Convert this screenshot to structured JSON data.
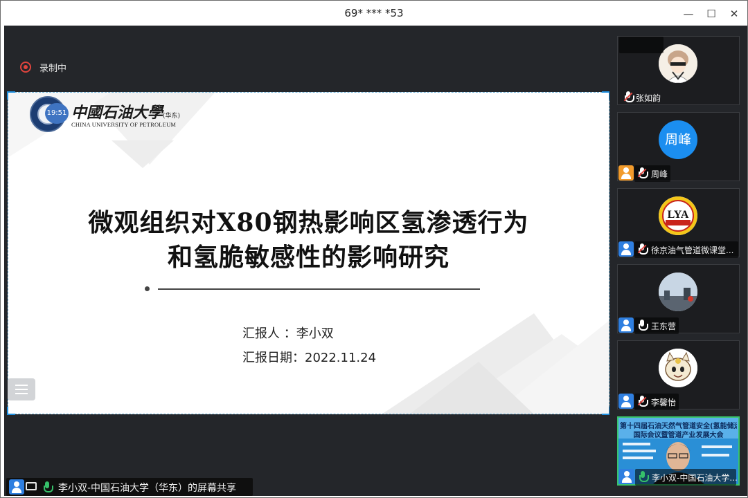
{
  "window": {
    "title": "69* *** *53",
    "minimize_glyph": "—",
    "maximize_glyph": "☐",
    "close_glyph": "✕"
  },
  "recording": {
    "label": "录制中",
    "color": "#e0443e"
  },
  "slide": {
    "clock_badge": "19:51",
    "logo_cn": "中國石油大學",
    "logo_cn_suffix": "(华东)",
    "logo_en": "CHINA UNIVERSITY OF PETROLEUM",
    "title_line1": "微观组织对X80钢热影响区氢渗透行为",
    "title_line2": "和氢脆敏感性的影响研究",
    "reporter": "汇报人  ：李小双",
    "date": "汇报日期：2022.11.24"
  },
  "share_bar": {
    "text": "李小双-中国石油大学（华东）的屏幕共享",
    "icons": [
      "user-icon",
      "screen-share-icon",
      "mic-active-icon"
    ]
  },
  "participants": [
    {
      "name": "张如韵",
      "avatar": "cartoon-girl-avatar",
      "mic": "muted",
      "show_user_icon": false
    },
    {
      "name": "周峰",
      "avatar_text": "周峰",
      "avatar": "text-avatar",
      "mic": "muted",
      "show_user_icon": true,
      "user_icon_color": "#f29b2c"
    },
    {
      "name": "徐京油气管道微课堂...",
      "avatar": "lya-logo-avatar",
      "mic": "muted",
      "show_user_icon": true,
      "user_icon_color": "#2f7fe0"
    },
    {
      "name": "王东营",
      "avatar": "landscape-photo-avatar",
      "mic": "on",
      "show_user_icon": true,
      "user_icon_color": "#2f7fe0"
    },
    {
      "name": "李馨怡",
      "avatar": "cartoon-cat-avatar",
      "mic": "muted",
      "show_user_icon": true,
      "user_icon_color": "#2f7fe0"
    },
    {
      "name": "李小双-中国石油大学...",
      "avatar": "video-feed",
      "mic": "speaking",
      "show_user_icon": true,
      "user_icon_color": "#2f7fe0",
      "video_banner_line1": "第十四届石油天然气管道安全(氢能储运)",
      "video_banner_line2": "国际会议暨管道产业发展大会"
    }
  ],
  "colors": {
    "stage_bg": "#24262a",
    "accent_blue": "#1d8fe0",
    "speaking_green": "#39c46d"
  }
}
